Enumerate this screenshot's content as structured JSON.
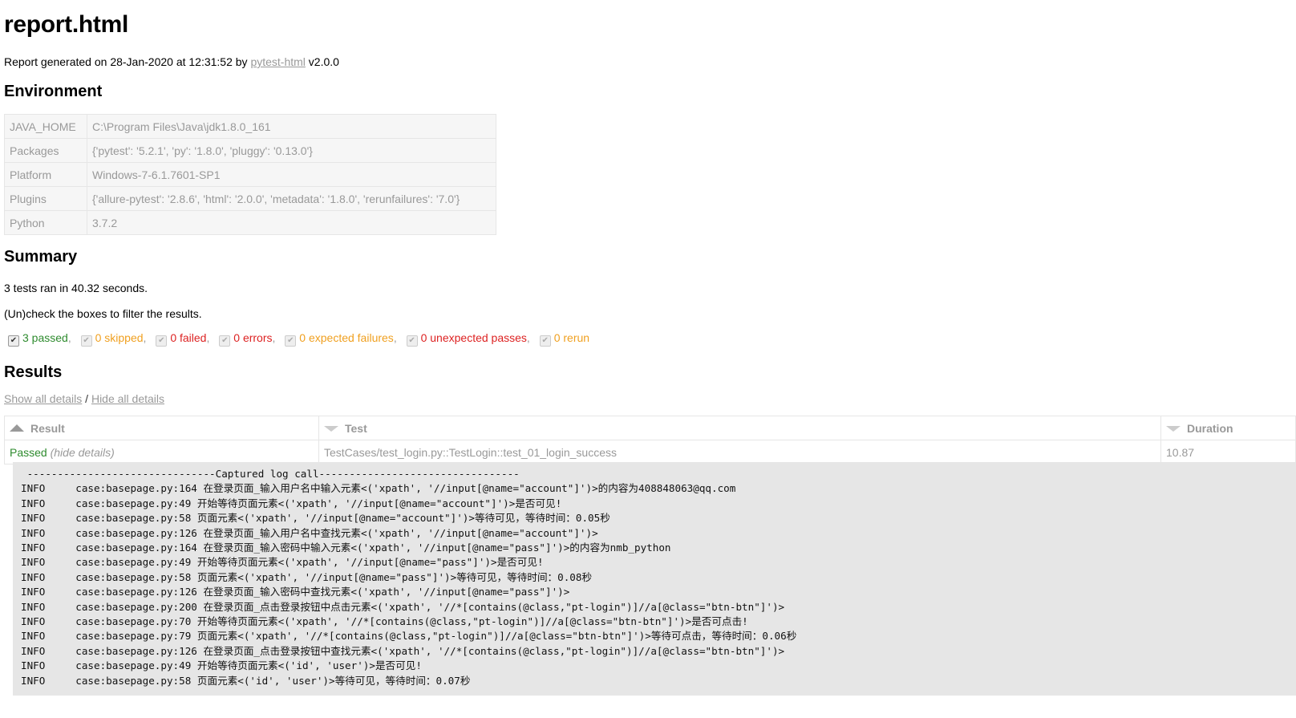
{
  "title": "report.html",
  "generated": {
    "prefix": "Report generated on 28-Jan-2020 at 12:31:52 by ",
    "link": "pytest-html",
    "suffix": " v2.0.0"
  },
  "environment": {
    "heading": "Environment",
    "rows": [
      {
        "key": "JAVA_HOME",
        "value": "C:\\Program Files\\Java\\jdk1.8.0_161"
      },
      {
        "key": "Packages",
        "value": "{'pytest': '5.2.1', 'py': '1.8.0', 'pluggy': '0.13.0'}"
      },
      {
        "key": "Platform",
        "value": "Windows-7-6.1.7601-SP1"
      },
      {
        "key": "Plugins",
        "value": "{'allure-pytest': '2.8.6', 'html': '2.0.0', 'metadata': '1.8.0', 'rerunfailures': '7.0'}"
      },
      {
        "key": "Python",
        "value": "3.7.2"
      }
    ]
  },
  "summary": {
    "heading": "Summary",
    "ran": "3 tests ran in 40.32 seconds.",
    "instruction": "(Un)check the boxes to filter the results.",
    "filters": [
      {
        "label": "3 passed",
        "color": "#2e8b2e",
        "checked": true
      },
      {
        "label": "0 skipped",
        "color": "#f0a020",
        "checked": true
      },
      {
        "label": "0 failed",
        "color": "#dd2222",
        "checked": true
      },
      {
        "label": "0 errors",
        "color": "#dd2222",
        "checked": true
      },
      {
        "label": "0 expected failures",
        "color": "#f0a020",
        "checked": true
      },
      {
        "label": "0 unexpected passes",
        "color": "#dd2222",
        "checked": true
      },
      {
        "label": "0 rerun",
        "color": "#f0a020",
        "checked": true
      }
    ]
  },
  "results": {
    "heading": "Results",
    "show_all": "Show all details",
    "separator": " / ",
    "hide_all": "Hide all details",
    "columns": {
      "result": "Result",
      "test": "Test",
      "duration": "Duration"
    },
    "row": {
      "result": "Passed",
      "hide_details": "(hide details)",
      "test": "TestCases/test_login.py::TestLogin::test_01_login_success",
      "duration": "10.87"
    },
    "log_lines": [
      " -------------------------------Captured log call---------------------------------",
      "INFO     case:basepage.py:164 在登录页面_输入用户名中输入元素<('xpath', '//input[@name=\"account\"]')>的内容为408848063@qq.com",
      "INFO     case:basepage.py:49 开始等待页面元素<('xpath', '//input[@name=\"account\"]')>是否可见!",
      "INFO     case:basepage.py:58 页面元素<('xpath', '//input[@name=\"account\"]')>等待可见，等待时间：0.05秒",
      "INFO     case:basepage.py:126 在登录页面_输入用户名中查找元素<('xpath', '//input[@name=\"account\"]')>",
      "INFO     case:basepage.py:164 在登录页面_输入密码中输入元素<('xpath', '//input[@name=\"pass\"]')>的内容为nmb_python",
      "INFO     case:basepage.py:49 开始等待页面元素<('xpath', '//input[@name=\"pass\"]')>是否可见!",
      "INFO     case:basepage.py:58 页面元素<('xpath', '//input[@name=\"pass\"]')>等待可见，等待时间：0.08秒",
      "INFO     case:basepage.py:126 在登录页面_输入密码中查找元素<('xpath', '//input[@name=\"pass\"]')>",
      "INFO     case:basepage.py:200 在登录页面_点击登录按钮中点击元素<('xpath', '//*[contains(@class,\"pt-login\")]//a[@class=\"btn-btn\"]')>",
      "INFO     case:basepage.py:70 开始等待页面元素<('xpath', '//*[contains(@class,\"pt-login\")]//a[@class=\"btn-btn\"]')>是否可点击!",
      "INFO     case:basepage.py:79 页面元素<('xpath', '//*[contains(@class,\"pt-login\")]//a[@class=\"btn-btn\"]')>等待可点击，等待时间：0.06秒",
      "INFO     case:basepage.py:126 在登录页面_点击登录按钮中查找元素<('xpath', '//*[contains(@class,\"pt-login\")]//a[@class=\"btn-btn\"]')>",
      "INFO     case:basepage.py:49 开始等待页面元素<('id', 'user')>是否可见!",
      "INFO     case:basepage.py:58 页面元素<('id', 'user')>等待可见，等待时间：0.07秒"
    ]
  }
}
